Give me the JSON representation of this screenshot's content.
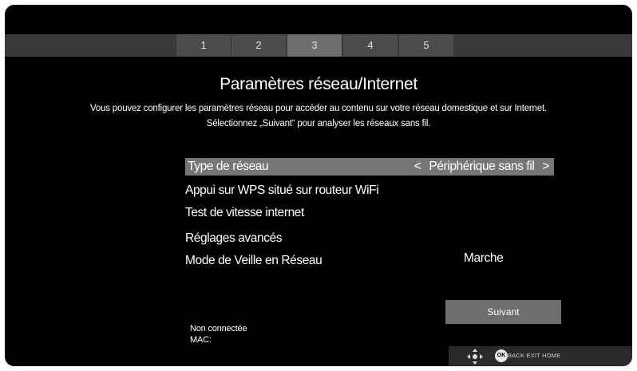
{
  "steps": [
    "1",
    "2",
    "3",
    "4",
    "5"
  ],
  "active_step": "3",
  "page": {
    "title": "Paramètres réseau/Internet",
    "description_line1": "Vous pouvez configurer les paramètres réseau pour accéder au contenu sur votre réseau domestique et sur Internet.",
    "description_line2": "Sélectionnez „Suivant“ pour analyser les réseaux sans fil."
  },
  "menu": {
    "network_type": {
      "label": "Type de réseau",
      "value": "Périphérique sans fil",
      "prev_arrow": "<",
      "next_arrow": ">"
    },
    "wps": {
      "label": "Appui sur WPS situé sur routeur WiFi"
    },
    "speed_test": {
      "label": "Test de vitesse internet"
    },
    "advanced": {
      "label": "Réglages avancés"
    },
    "standby": {
      "label": "Mode de Veille en Réseau",
      "value": "Marche"
    }
  },
  "next_button": "Suivant",
  "status": {
    "connection": "Non connectée",
    "mac": "MAC:"
  },
  "footer": {
    "ok_label": "OK",
    "hint": "BACK EXIT HOME"
  },
  "colors": {
    "highlight": "#767676",
    "background": "#000000",
    "step_bar": "#3a3a3a"
  }
}
